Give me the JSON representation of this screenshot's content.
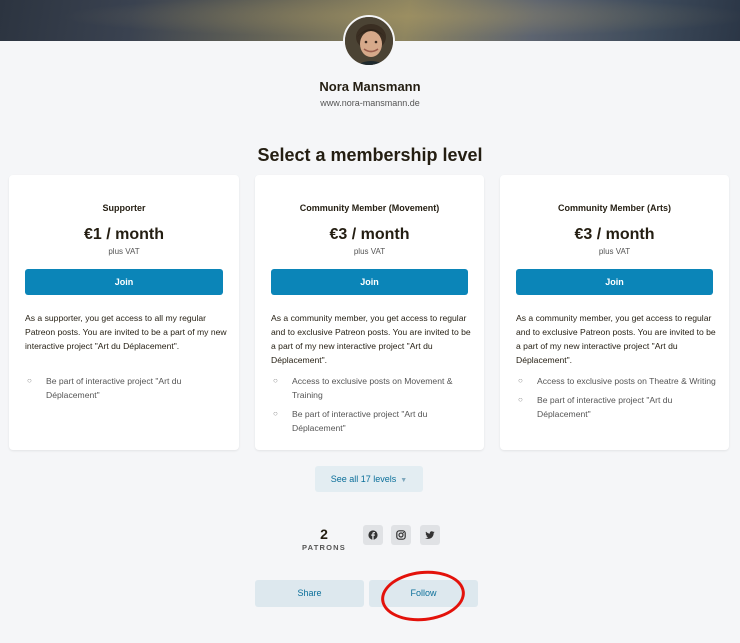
{
  "creator": {
    "name": "Nora Mansmann",
    "url": "www.nora-mansmann.de"
  },
  "section_title": "Select a membership level",
  "tiers": [
    {
      "name": "Supporter",
      "price": "€1 / month",
      "vat": "plus VAT",
      "join_label": "Join",
      "description": "As a supporter, you get access to all my regular Patreon posts. You are invited to be a part of my new interactive project \"Art du Déplacement\".",
      "benefits": [
        "Be part of interactive project \"Art du Déplacement\""
      ]
    },
    {
      "name": "Community Member (Movement)",
      "price": "€3 / month",
      "vat": "plus VAT",
      "join_label": "Join",
      "description": "As a community member, you get access to regular and to exclusive Patreon posts. You are invited to be a part of my new interactive project \"Art du Déplacement\".",
      "benefits": [
        "Access to exclusive posts on Movement & Training",
        "Be part of interactive project \"Art du Déplacement\""
      ]
    },
    {
      "name": "Community Member (Arts)",
      "price": "€3 / month",
      "vat": "plus VAT",
      "join_label": "Join",
      "description": "As a community member, you get access to regular and to exclusive Patreon posts. You are invited to be a part of my new interactive project \"Art du Déplacement\".",
      "benefits": [
        "Access to exclusive posts on Theatre & Writing",
        "Be part of interactive project \"Art du Déplacement\""
      ]
    }
  ],
  "see_all_label": "See all 17 levels",
  "patrons": {
    "count": "2",
    "label": "PATRONS"
  },
  "social_icons": [
    "facebook-icon",
    "instagram-icon",
    "twitter-icon"
  ],
  "actions": {
    "share_label": "Share",
    "follow_label": "Follow"
  },
  "colors": {
    "accent": "#0b85b8",
    "annotation": "#e3120b"
  }
}
